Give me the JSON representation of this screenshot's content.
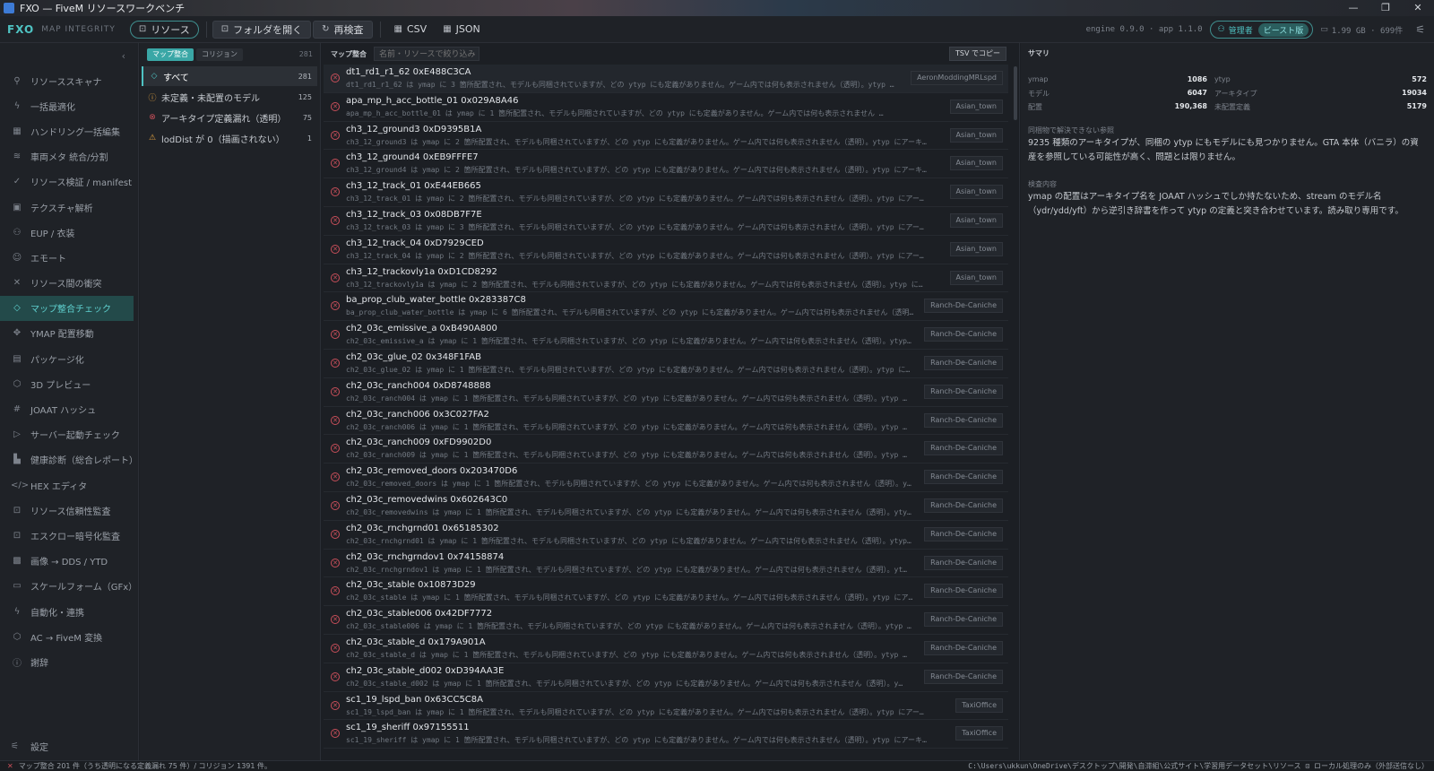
{
  "window": {
    "title": "FXO — FiveM リソースワークベンチ",
    "buttons": [
      "—",
      "❐",
      "✕"
    ]
  },
  "toolbar": {
    "brand": "FXO",
    "brand_sub": "MAP INTEGRITY",
    "resource_btn": "リソース",
    "open_folder_btn": "フォルダを開く",
    "recheck_btn": "再検査",
    "csv_btn": "CSV",
    "json_btn": "JSON",
    "engine": "engine 0.9.0 · app 1.1.0",
    "admin": "管理者",
    "build": "ビースト版",
    "memory": "1.99 GB · 699件"
  },
  "sidebar": {
    "items": [
      {
        "label": "リソーススキャナ",
        "icon": "search-icon",
        "glyph": "⚲"
      },
      {
        "label": "一括最適化",
        "icon": "bolt-icon",
        "glyph": "ϟ"
      },
      {
        "label": "ハンドリング一括編集",
        "icon": "grid-icon",
        "glyph": "▦"
      },
      {
        "label": "車両メタ 統合/分割",
        "icon": "layers-icon",
        "glyph": "≋"
      },
      {
        "label": "リソース検証 / manifest",
        "icon": "check-icon",
        "glyph": "✓"
      },
      {
        "label": "テクスチャ解析",
        "icon": "image-icon",
        "glyph": "▣"
      },
      {
        "label": "EUP / 衣装",
        "icon": "user-icon",
        "glyph": "⚇"
      },
      {
        "label": "エモート",
        "icon": "smile-icon",
        "glyph": "☺"
      },
      {
        "label": "リソース間の衝突",
        "icon": "cross-icon",
        "glyph": "✕"
      },
      {
        "label": "マップ整合チェック",
        "icon": "diamond-icon",
        "glyph": "◇",
        "active": true
      },
      {
        "label": "YMAP 配置移動",
        "icon": "move-icon",
        "glyph": "✥"
      },
      {
        "label": "パッケージ化",
        "icon": "package-icon",
        "glyph": "▤"
      },
      {
        "label": "3D プレビュー",
        "icon": "cube-icon",
        "glyph": "⬡"
      },
      {
        "label": "JOAAT ハッシュ",
        "icon": "hash-icon",
        "glyph": "#"
      },
      {
        "label": "サーバー起動チェック",
        "icon": "play-icon",
        "glyph": "▷"
      },
      {
        "label": "健康診断（総合レポート）",
        "icon": "chart-icon",
        "glyph": "▙"
      },
      {
        "label": "HEX エディタ",
        "icon": "code-icon",
        "glyph": "</>"
      },
      {
        "label": "リソース信頼性監査",
        "icon": "lock-icon",
        "glyph": "⊡"
      },
      {
        "label": "エスクロー暗号化監査",
        "icon": "lock-icon",
        "glyph": "⊡"
      },
      {
        "label": "画像 → DDS / YTD",
        "icon": "checker-icon",
        "glyph": "▩"
      },
      {
        "label": "スケールフォーム（GFx）",
        "icon": "monitor-icon",
        "glyph": "▭"
      },
      {
        "label": "自動化・連携",
        "icon": "bolt-icon",
        "glyph": "ϟ"
      },
      {
        "label": "AC → FiveM 変換",
        "icon": "cube-icon",
        "glyph": "⬡"
      },
      {
        "label": "謝辞",
        "icon": "info-icon",
        "glyph": "ⓘ"
      }
    ],
    "settings": "設定"
  },
  "categories": {
    "tabs": [
      "マップ整合",
      "コリジョン"
    ],
    "total": "281",
    "items": [
      {
        "label": "すべて",
        "count": "281",
        "icon": "diamond-icon",
        "glyph": "◇",
        "color": "#4fc3c3",
        "active": true
      },
      {
        "label": "未定義・未配置のモデル",
        "count": "125",
        "icon": "info-icon",
        "glyph": "ⓘ",
        "color": "#e0a040"
      },
      {
        "label": "アーキタイプ定義漏れ（透明）",
        "count": "75",
        "icon": "error-icon",
        "glyph": "⊗",
        "color": "#c94f5a"
      },
      {
        "label": "lodDist が 0（描画されない）",
        "count": "1",
        "icon": "warning-icon",
        "glyph": "⚠",
        "color": "#e0a040"
      }
    ]
  },
  "main": {
    "label": "マップ整合",
    "filter_placeholder": "名前・リソースで絞り込み",
    "tsv_btn": "TSV でコピー",
    "rows": [
      {
        "name": "dt1_rd1_r1_62 0xE488C3CA",
        "desc": "dt1_rd1_r1_62 は ymap に 3 箇所配置され、モデルも同梱されていますが、どの ytyp にも定義がありません。ゲーム内では何も表示されません（透明）。ytyp …",
        "tag": "AeronModdingMRLspd"
      },
      {
        "name": "apa_mp_h_acc_bottle_01 0x029A8A46",
        "desc": "apa_mp_h_acc_bottle_01 は ymap に 1 箇所配置され、モデルも同梱されていますが、どの ytyp にも定義がありません。ゲーム内では何も表示されません …",
        "tag": "Asian_town"
      },
      {
        "name": "ch3_12_ground3 0xD9395B1A",
        "desc": "ch3_12_ground3 は ymap に 2 箇所配置され、モデルも同梱されていますが、どの ytyp にも定義がありません。ゲーム内では何も表示されません（透明）。ytyp にアーキ…",
        "tag": "Asian_town"
      },
      {
        "name": "ch3_12_ground4 0xEB9FFFE7",
        "desc": "ch3_12_ground4 は ymap に 2 箇所配置され、モデルも同梱されていますが、どの ytyp にも定義がありません。ゲーム内では何も表示されません（透明）。ytyp にアーキ…",
        "tag": "Asian_town"
      },
      {
        "name": "ch3_12_track_01 0xE44EB665",
        "desc": "ch3_12_track_01 は ymap に 2 箇所配置され、モデルも同梱されていますが、どの ytyp にも定義がありません。ゲーム内では何も表示されません（透明）。ytyp にアーキ…",
        "tag": "Asian_town"
      },
      {
        "name": "ch3_12_track_03 0x08DB7F7E",
        "desc": "ch3_12_track_03 は ymap に 3 箇所配置され、モデルも同梱されていますが、どの ytyp にも定義がありません。ゲーム内では何も表示されません（透明）。ytyp にアーキ…",
        "tag": "Asian_town"
      },
      {
        "name": "ch3_12_track_04 0xD7929CED",
        "desc": "ch3_12_track_04 は ymap に 2 箇所配置され、モデルも同梱されていますが、どの ytyp にも定義がありません。ゲーム内では何も表示されません（透明）。ytyp にアーキ…",
        "tag": "Asian_town"
      },
      {
        "name": "ch3_12_trackovly1a 0xD1CD8292",
        "desc": "ch3_12_trackovly1a は ymap に 2 箇所配置され、モデルも同梱されていますが、どの ytyp にも定義がありません。ゲーム内では何も表示されません（透明）。ytyp にア…",
        "tag": "Asian_town"
      },
      {
        "name": "ba_prop_club_water_bottle 0x283387C8",
        "desc": "ba_prop_club_water_bottle は ymap に 6 箇所配置され、モデルも同梱されていますが、どの ytyp にも定義がありません。ゲーム内では何も表示されません（透明…",
        "tag": "Ranch-De-Caniche"
      },
      {
        "name": "ch2_03c_emissive_a 0xB490A800",
        "desc": "ch2_03c_emissive_a は ymap に 1 箇所配置され、モデルも同梱されていますが、どの ytyp にも定義がありません。ゲーム内では何も表示されません（透明）。ytyp…",
        "tag": "Ranch-De-Caniche"
      },
      {
        "name": "ch2_03c_glue_02 0x348F1FAB",
        "desc": "ch2_03c_glue_02 は ymap に 1 箇所配置され、モデルも同梱されていますが、どの ytyp にも定義がありません。ゲーム内では何も表示されません（透明）。ytyp に…",
        "tag": "Ranch-De-Caniche"
      },
      {
        "name": "ch2_03c_ranch004 0xD8748888",
        "desc": "ch2_03c_ranch004 は ymap に 1 箇所配置され、モデルも同梱されていますが、どの ytyp にも定義がありません。ゲーム内では何も表示されません（透明）。ytyp …",
        "tag": "Ranch-De-Caniche"
      },
      {
        "name": "ch2_03c_ranch006 0x3C027FA2",
        "desc": "ch2_03c_ranch006 は ymap に 1 箇所配置され、モデルも同梱されていますが、どの ytyp にも定義がありません。ゲーム内では何も表示されません（透明）。ytyp …",
        "tag": "Ranch-De-Caniche"
      },
      {
        "name": "ch2_03c_ranch009 0xFD9902D0",
        "desc": "ch2_03c_ranch009 は ymap に 1 箇所配置され、モデルも同梱されていますが、どの ytyp にも定義がありません。ゲーム内では何も表示されません（透明）。ytyp …",
        "tag": "Ranch-De-Caniche"
      },
      {
        "name": "ch2_03c_removed_doors 0x203470D6",
        "desc": "ch2_03c_removed_doors は ymap に 1 箇所配置され、モデルも同梱されていますが、どの ytyp にも定義がありません。ゲーム内では何も表示されません（透明）。y…",
        "tag": "Ranch-De-Caniche"
      },
      {
        "name": "ch2_03c_removedwins 0x602643C0",
        "desc": "ch2_03c_removedwins は ymap に 1 箇所配置され、モデルも同梱されていますが、どの ytyp にも定義がありません。ゲーム内では何も表示されません（透明）。yty…",
        "tag": "Ranch-De-Caniche"
      },
      {
        "name": "ch2_03c_rnchgrnd01 0x65185302",
        "desc": "ch2_03c_rnchgrnd01 は ymap に 1 箇所配置され、モデルも同梱されていますが、どの ytyp にも定義がありません。ゲーム内では何も表示されません（透明）。ytyp…",
        "tag": "Ranch-De-Caniche"
      },
      {
        "name": "ch2_03c_rnchgrndov1 0x74158874",
        "desc": "ch2_03c_rnchgrndov1 は ymap に 1 箇所配置され、モデルも同梱されていますが、どの ytyp にも定義がありません。ゲーム内では何も表示されません（透明）。yt…",
        "tag": "Ranch-De-Caniche"
      },
      {
        "name": "ch2_03c_stable 0x10873D29",
        "desc": "ch2_03c_stable は ymap に 1 箇所配置され、モデルも同梱されていますが、どの ytyp にも定義がありません。ゲーム内では何も表示されません（透明）。ytyp にア…",
        "tag": "Ranch-De-Caniche"
      },
      {
        "name": "ch2_03c_stable006 0x42DF7772",
        "desc": "ch2_03c_stable006 は ymap に 1 箇所配置され、モデルも同梱されていますが、どの ytyp にも定義がありません。ゲーム内では何も表示されません（透明）。ytyp …",
        "tag": "Ranch-De-Caniche"
      },
      {
        "name": "ch2_03c_stable_d 0x179A901A",
        "desc": "ch2_03c_stable_d は ymap に 1 箇所配置され、モデルも同梱されていますが、どの ytyp にも定義がありません。ゲーム内では何も表示されません（透明）。ytyp …",
        "tag": "Ranch-De-Caniche"
      },
      {
        "name": "ch2_03c_stable_d002 0xD394AA3E",
        "desc": "ch2_03c_stable_d002 は ymap に 1 箇所配置され、モデルも同梱されていますが、どの ytyp にも定義がありません。ゲーム内では何も表示されません（透明）。y…",
        "tag": "Ranch-De-Caniche"
      },
      {
        "name": "sc1_19_lspd_ban 0x63CC5C8A",
        "desc": "sc1_19_lspd_ban は ymap に 1 箇所配置され、モデルも同梱されていますが、どの ytyp にも定義がありません。ゲーム内では何も表示されません（透明）。ytyp にアーキタ…",
        "tag": "TaxiOffice"
      },
      {
        "name": "sc1_19_sheriff 0x97155511",
        "desc": "sc1_19_sheriff は ymap に 1 箇所配置され、モデルも同梱されていますが、どの ytyp にも定義がありません。ゲーム内では何も表示されません（透明）。ytyp にアーキタイ…",
        "tag": "TaxiOffice"
      }
    ]
  },
  "summary": {
    "title": "サマリ",
    "stats": [
      {
        "k": "ymap",
        "v": "1086",
        "k2": "ytyp",
        "v2": "572"
      },
      {
        "k": "モデル",
        "v": "6047",
        "k2": "アーキタイプ",
        "v2": "19034"
      },
      {
        "k": "配置",
        "v": "190,368",
        "k2": "未配置定義",
        "v2": "5179"
      }
    ],
    "unresolved_title": "同梱物で解決できない参照",
    "unresolved_body": "9235 種類のアーキタイプが、同梱の ytyp にもモデルにも見つかりません。GTA 本体（バニラ）の資産を参照している可能性が高く、問題とは限りません。",
    "method_title": "検査内容",
    "method_body": "ymap の配置はアーキタイプ名を JOAAT ハッシュでしか持たないため、stream のモデル名（ydr/ydd/yft）から逆引き辞書を作って ytyp の定義と突き合わせています。読み取り専用です。"
  },
  "status": {
    "text": "マップ整合 201 件（うち透明になる定義漏れ 75 件）/ コリジョン 1391 件。",
    "path": "C:\\Users\\ukkun\\OneDrive\\デスクトップ\\開発\\自滞組\\公式サイト\\学習用データセット\\リソース  ⊡ ローカル処理のみ（外部送信なし）"
  },
  "colors": {
    "accent": "#4fc3c3",
    "error": "#c94f5a",
    "warning": "#e0a040"
  }
}
